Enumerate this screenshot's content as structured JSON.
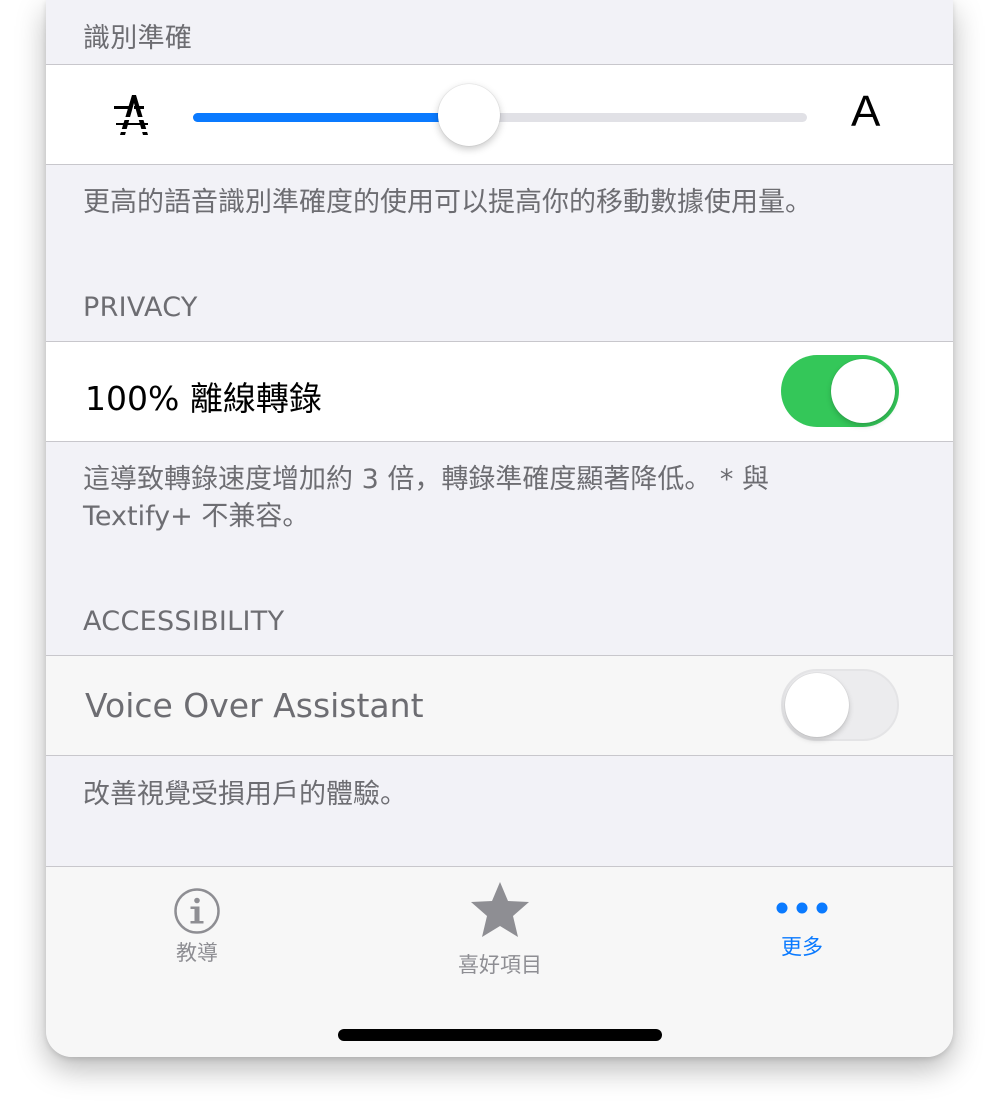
{
  "accuracy": {
    "header": "識別準確",
    "slider": {
      "min_label": "A",
      "max_label": "A",
      "value": 0.45
    },
    "footer": "更高的語音識別準確度的使用可以提高你的移動數據使用量。"
  },
  "privacy": {
    "header": "PRIVACY",
    "offline_label": "100% 離線轉錄",
    "offline_enabled": true,
    "footer_line1": "這導致轉錄速度增加約 3 倍，轉錄準確度顯著降低。 * 與",
    "footer_line2": "Textify+ 不兼容。"
  },
  "accessibility": {
    "header": "ACCESSIBILITY",
    "voice_over_label": "Voice Over Assistant",
    "voice_over_enabled": false,
    "footer": "改善視覺受損用戶的體驗。"
  },
  "tabbar": {
    "tabs": [
      {
        "label": "教導",
        "icon": "info-icon",
        "active": false
      },
      {
        "label": "喜好項目",
        "icon": "star-icon",
        "active": false
      },
      {
        "label": "更多",
        "icon": "more-icon",
        "active": true
      }
    ]
  },
  "colors": {
    "accent": "#0a7aff",
    "switch_on": "#34c759",
    "background": "#f2f2f7"
  }
}
